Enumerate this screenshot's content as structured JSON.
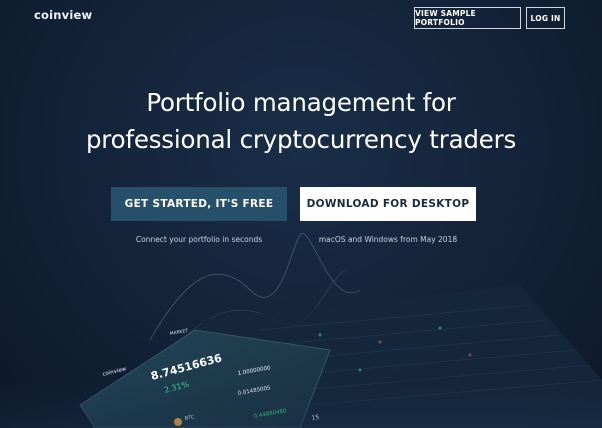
{
  "header": {
    "logo": "coinview",
    "view_sample": "VIEW SAMPLE PORTFOLIO",
    "login": "LOG IN"
  },
  "hero": {
    "headline_line1": "Portfolio management for",
    "headline_line2": "professional cryptocurrency traders",
    "primary_cta": "GET STARTED, IT'S FREE",
    "primary_caption": "Connect your portfolio in seconds",
    "secondary_cta": "DOWNLOAD FOR DESKTOP",
    "secondary_caption": "macOS and Windows from May 2018"
  },
  "device_preview": {
    "app_name": "coinview",
    "balance": "8.74516636",
    "change": "2.31%",
    "sub_value": "1.00000000",
    "sub_value2": "0.01485005",
    "sub_value3": "0.44880480",
    "btc_label": "BTC",
    "count": "15",
    "tag": "MARKET"
  },
  "colors": {
    "background": "#132238",
    "primary_button": "#27506a",
    "accent_green": "#3fd08a",
    "accent_teal": "#4fd6c2"
  }
}
